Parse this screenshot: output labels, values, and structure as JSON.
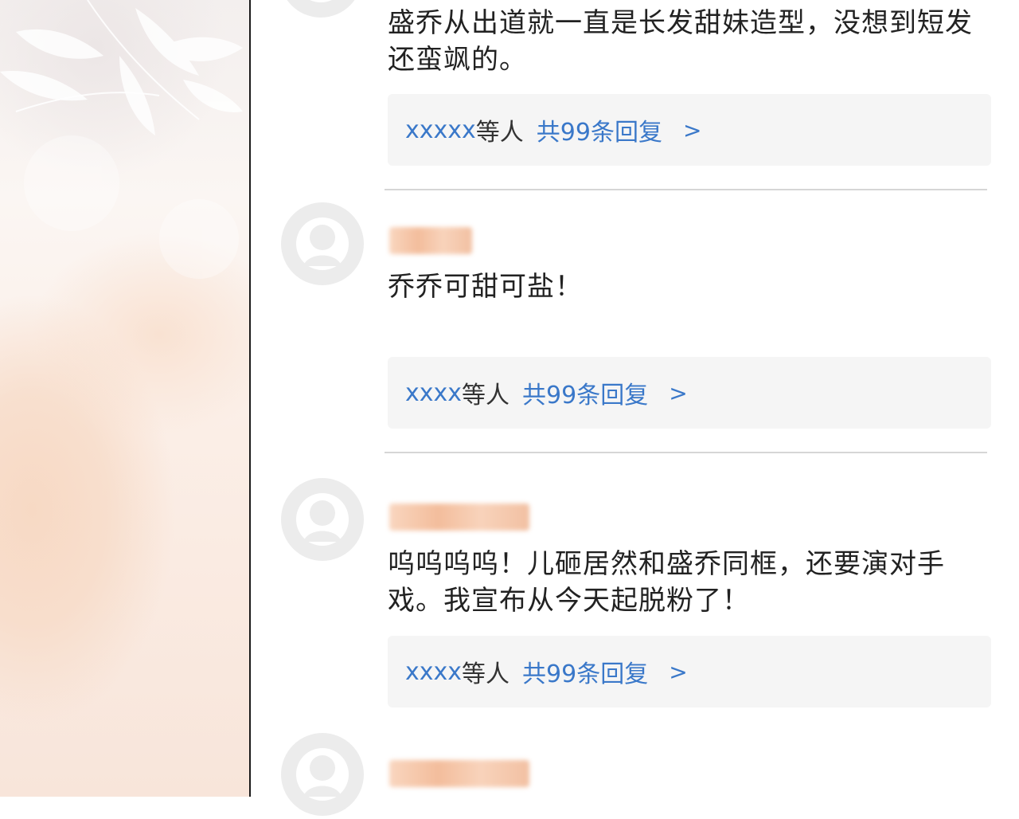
{
  "comments": [
    {
      "text": "盛乔从出道就一直是长发甜妹造型，没想到短发还蛮飒的。",
      "reply_names": "xxxxx",
      "reply_etc": " 等人",
      "reply_count": "共99条回复",
      "reply_chevron": ">"
    },
    {
      "text": "乔乔可甜可盐！",
      "reply_names": "xxxx",
      "reply_etc": "等人",
      "reply_count": "共99条回复",
      "reply_chevron": ">"
    },
    {
      "text": "呜呜呜呜！儿砸居然和盛乔同框，还要演对手戏。我宣布从今天起脱粉了！",
      "reply_names": "xxxx",
      "reply_etc": "等人",
      "reply_count": "共99条回复",
      "reply_chevron": ">"
    }
  ],
  "icons": {
    "avatar": "default-user-avatar-icon",
    "chevron": "chevron-right-icon"
  },
  "colors": {
    "link": "#3a78c9",
    "reply_bg": "#f5f5f5",
    "divider": "#d6d6d6",
    "username_blur": "#f3bd9c"
  }
}
